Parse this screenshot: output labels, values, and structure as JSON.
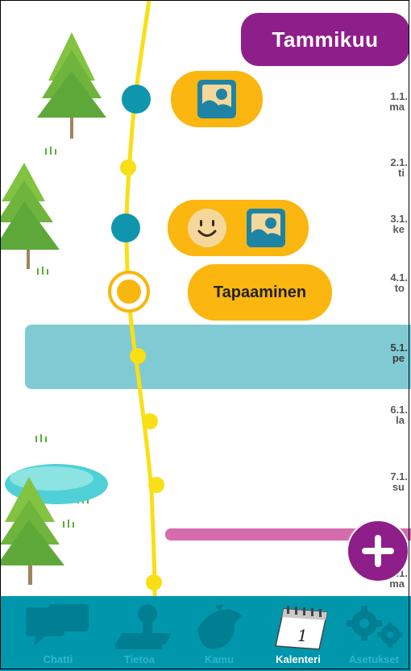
{
  "header": {
    "month": "Tammikuu"
  },
  "days": [
    {
      "date": "1.1.",
      "weekday": "ma"
    },
    {
      "date": "2.1.",
      "weekday": "ti"
    },
    {
      "date": "3.1.",
      "weekday": "ke"
    },
    {
      "date": "4.1.",
      "weekday": "to"
    },
    {
      "date": "5.1.",
      "weekday": "pe"
    },
    {
      "date": "6.1.",
      "weekday": "la"
    },
    {
      "date": "7.1.",
      "weekday": "su"
    },
    {
      "date": "8.1.",
      "weekday": "ma"
    }
  ],
  "events": {
    "meeting_label": "Tapaaminen",
    "icons": [
      "image-icon",
      "smiley-icon",
      "image-icon"
    ]
  },
  "nav": {
    "items": [
      {
        "label": "Chatti",
        "icon": "chat-icon"
      },
      {
        "label": "Tietoa",
        "icon": "stamp-icon"
      },
      {
        "label": "Kamu",
        "icon": "bird-icon"
      },
      {
        "label": "Kalenteri",
        "icon": "calendar-icon",
        "badge": "1"
      },
      {
        "label": "Asetukset",
        "icon": "gears-icon"
      }
    ]
  },
  "colors": {
    "timeline": "#f9df15",
    "accent_purple": "#8e1e8a",
    "event_orange": "#fbb60f",
    "today_band": "#80cad4",
    "nav_bg": "#0097ad",
    "dot_teal": "#0f96ac"
  }
}
